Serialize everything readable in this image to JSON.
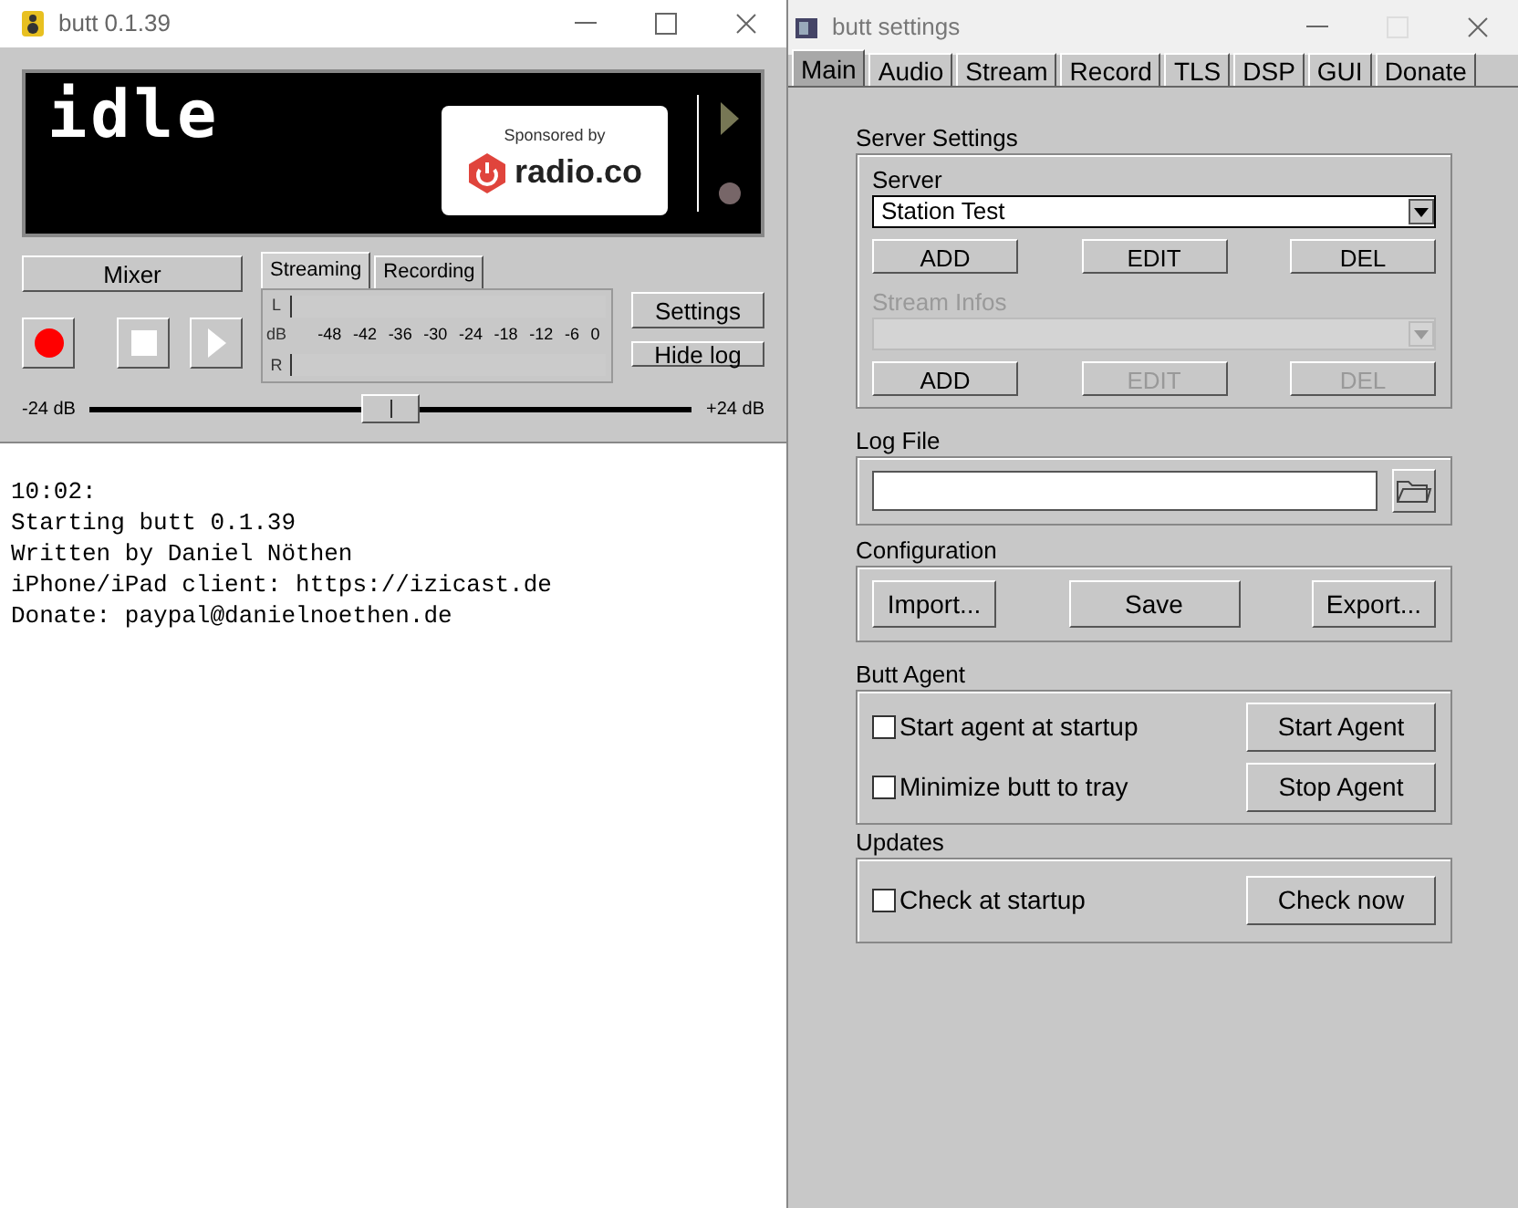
{
  "main_window": {
    "title": "butt 0.1.39",
    "display": {
      "status": "idle",
      "sponsor_caption": "Sponsored by",
      "sponsor_name": "radio.co"
    },
    "mixer_button": "Mixer",
    "meter_tabs": [
      {
        "label": "Streaming",
        "selected": true
      },
      {
        "label": "Recording",
        "selected": false
      }
    ],
    "meter": {
      "left_label": "L",
      "db_label": "dB",
      "right_label": "R",
      "scale": [
        "-48",
        "-42",
        "-36",
        "-30",
        "-24",
        "-18",
        "-12",
        "-6",
        "0"
      ]
    },
    "settings_button": "Settings",
    "hide_log_button": "Hide log",
    "gain": {
      "min_label": "-24 dB",
      "max_label": "+24 dB",
      "level": 0.5
    },
    "log": [
      "10:02:",
      "Starting butt 0.1.39",
      "Written by Daniel Nöthen",
      "iPhone/iPad client: https://izicast.de",
      "Donate: paypal@danielnoethen.de"
    ]
  },
  "settings_window": {
    "title": "butt settings",
    "tabs": [
      {
        "label": "Main",
        "selected": true
      },
      {
        "label": "Audio",
        "selected": false
      },
      {
        "label": "Stream",
        "selected": false
      },
      {
        "label": "Record",
        "selected": false
      },
      {
        "label": "TLS",
        "selected": false
      },
      {
        "label": "DSP",
        "selected": false
      },
      {
        "label": "GUI",
        "selected": false
      },
      {
        "label": "Donate",
        "selected": false
      }
    ],
    "server_settings": {
      "title": "Server Settings",
      "server": {
        "label": "Server",
        "value": "Station Test",
        "disabled": false,
        "buttons": [
          {
            "label": "ADD",
            "disabled": false
          },
          {
            "label": "EDIT",
            "disabled": false
          },
          {
            "label": "DEL",
            "disabled": false
          }
        ]
      },
      "stream_infos": {
        "label": "Stream Infos",
        "disabled": true,
        "buttons": [
          {
            "label": "ADD",
            "disabled": false
          },
          {
            "label": "EDIT",
            "disabled": true
          },
          {
            "label": "DEL",
            "disabled": true
          }
        ]
      }
    },
    "log_file": {
      "title": "Log File"
    },
    "configuration": {
      "title": "Configuration",
      "buttons": [
        "Import...",
        "Save",
        "Export..."
      ]
    },
    "butt_agent": {
      "title": "Butt Agent",
      "rows": [
        {
          "label": "Start agent at startup",
          "checked": false,
          "button": "Start Agent"
        },
        {
          "label": "Minimize butt to tray",
          "checked": false,
          "button": "Stop Agent"
        }
      ]
    },
    "updates": {
      "title": "Updates",
      "rows": [
        {
          "label": "Check at startup",
          "checked": false,
          "button": "Check now"
        }
      ]
    }
  }
}
